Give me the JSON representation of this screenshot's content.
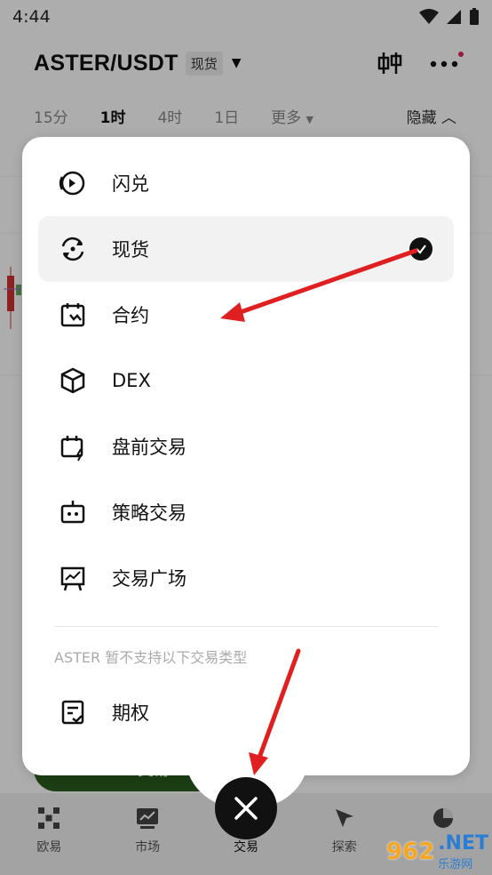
{
  "status": {
    "time": "4:44"
  },
  "header": {
    "pair": "ASTER/USDT",
    "market_badge": "现货"
  },
  "intervals": {
    "items": [
      "15分",
      "1时",
      "4时",
      "1日",
      "更多"
    ],
    "active": "1时",
    "hide_label": "隐藏"
  },
  "bottom_button": {
    "label": "交易"
  },
  "tabbar": {
    "items": [
      {
        "label": "欧易",
        "icon": "okx-logo-icon"
      },
      {
        "label": "市场",
        "icon": "chart-icon"
      },
      {
        "label": "交易",
        "icon": "close-icon"
      },
      {
        "label": "探索",
        "icon": "compass-icon"
      },
      {
        "label": "资产",
        "icon": "pie-chart-icon"
      }
    ]
  },
  "menu": {
    "items": [
      {
        "label": "闪兑",
        "icon": "swap-circle-icon",
        "selected": false
      },
      {
        "label": "现货",
        "icon": "spot-cycle-icon",
        "selected": true
      },
      {
        "label": "合约",
        "icon": "futures-calendar-icon",
        "selected": false
      },
      {
        "label": "DEX",
        "icon": "cube-icon",
        "selected": false
      },
      {
        "label": "盘前交易",
        "icon": "premarket-calendar-icon",
        "selected": false
      },
      {
        "label": "策略交易",
        "icon": "bot-icon",
        "selected": false
      },
      {
        "label": "交易广场",
        "icon": "board-chart-icon",
        "selected": false
      }
    ],
    "unsupported_note": "ASTER 暂不支持以下交易类型",
    "unsupported_items": [
      {
        "label": "期权",
        "icon": "options-doc-icon"
      }
    ]
  },
  "watermark": {
    "number": "962",
    "net": ".NET",
    "sub": "乐游网"
  },
  "colors": {
    "accent_red": "#e0245e",
    "arrow_red": "#e02020",
    "dark_green": "#2a5c1e"
  }
}
